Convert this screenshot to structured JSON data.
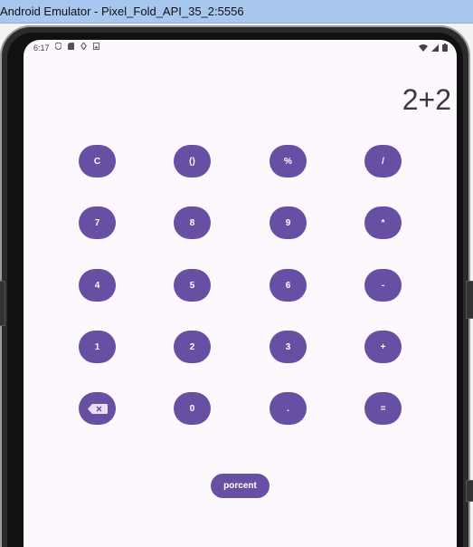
{
  "window": {
    "title": "Android Emulator - Pixel_Fold_API_35_2:5556"
  },
  "status_bar": {
    "time": "6:17"
  },
  "display": {
    "expression": "2+2"
  },
  "keypad": {
    "rows": [
      [
        "C",
        "()",
        "%",
        "/"
      ],
      [
        "7",
        "8",
        "9",
        "*"
      ],
      [
        "4",
        "5",
        "6",
        "-"
      ],
      [
        "1",
        "2",
        "3",
        "+"
      ],
      [
        "",
        "0",
        ".",
        "="
      ]
    ],
    "backspace_icon": "backspace-icon"
  },
  "porcent_button": {
    "label": "porcent"
  },
  "colors": {
    "accent": "#6750a4",
    "screen_background": "#fdf7fe",
    "title_bar": "#a8c7ef"
  }
}
